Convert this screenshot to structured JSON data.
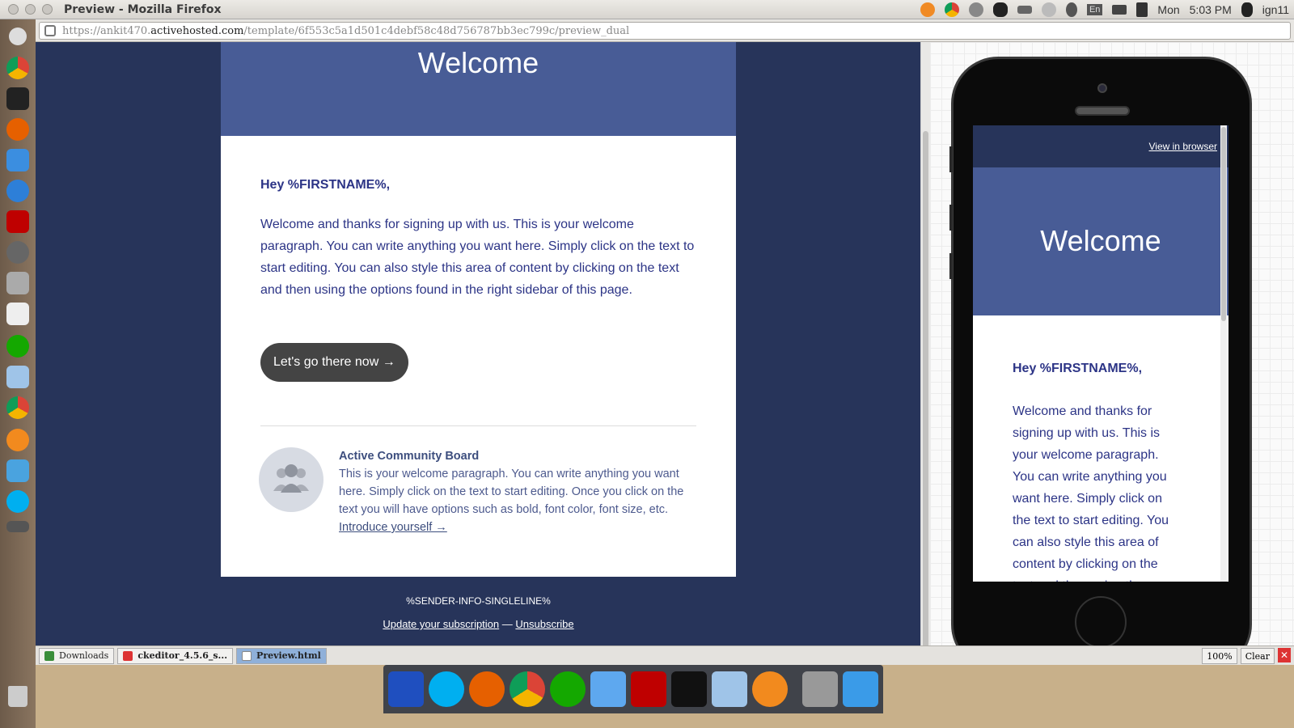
{
  "window": {
    "title": "Preview - Mozilla Firefox"
  },
  "systray": {
    "day": "Mon",
    "time": "5:03 PM",
    "user": "ign11",
    "keyboard": "En"
  },
  "url": {
    "prefix": "https://ankit470.",
    "domain": "activehosted.com",
    "path": "/template/6f553c5a1d501c4debf58c48d756787bb3ec799c/preview_dual"
  },
  "email": {
    "header_title": "Welcome",
    "greeting": "Hey %FIRSTNAME%,",
    "paragraph": "Welcome and thanks for signing up with us. This is your welcome paragraph. You can write anything you want here. Simply click on the text to start editing. You can also style this area of content by clicking on the text and then using the options found in the right sidebar of this page.",
    "cta_label": "Let's go there now →",
    "community": {
      "title": "Active Community Board",
      "text": "This is your welcome paragraph. You can write anything you want here. Simply click on the text to start editing. Once you click on the text you will have options such as bold, font color, font size, etc.",
      "link": "Introduce yourself →"
    },
    "footer": {
      "sender": "%SENDER-INFO-SINGLELINE%",
      "update_link": "Update your subscription",
      "separator": " — ",
      "unsubscribe_link": "Unsubscribe"
    }
  },
  "mobile": {
    "view_in_browser": "View in browser",
    "header_title": "Welcome",
    "greeting": "Hey %FIRSTNAME%,",
    "paragraph": "Welcome and thanks for signing up with us. This is your welcome paragraph. You can write anything you want here. Simply click on the text to start editing. You can also style this area of content by clicking on the text and then using the"
  },
  "downloads": {
    "items": [
      {
        "label": "Downloads",
        "icon": "downloads-icon"
      },
      {
        "label": "ckeditor_4.5.6_s...",
        "icon": "close-x-icon"
      },
      {
        "label": "Preview.html",
        "icon": "html-file-icon"
      }
    ],
    "zoom": "100%",
    "clear": "Clear"
  },
  "colors": {
    "email_header": "#485c96",
    "page_bg": "#27345a",
    "text": "#2c3486",
    "cta": "#444444"
  }
}
